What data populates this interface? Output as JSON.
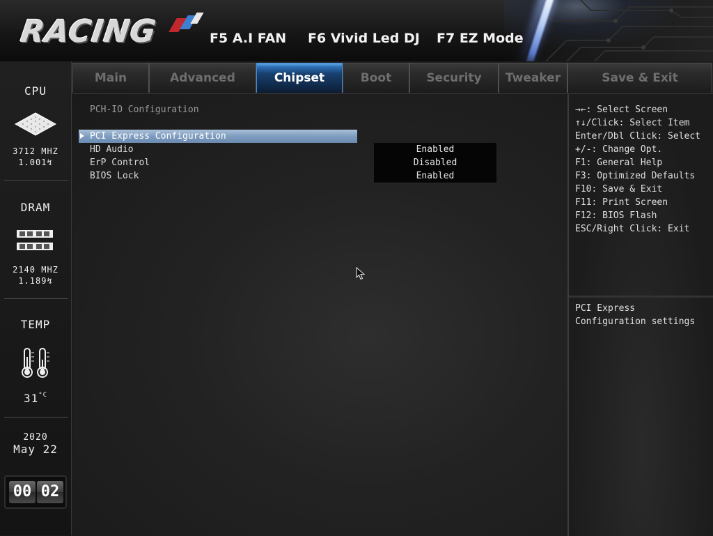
{
  "header": {
    "logo": "RACING",
    "hotkeys": [
      "F5 A.I FAN",
      "F6 Vivid Led DJ",
      "F7 EZ Mode"
    ]
  },
  "sidebar": {
    "cpu": {
      "title": "CPU",
      "freq": "3712 MHZ",
      "volt": "1.001"
    },
    "dram": {
      "title": "DRAM",
      "freq": "2140 MHZ",
      "volt": "1.189"
    },
    "temp": {
      "title": "TEMP",
      "value": "31",
      "unit": "°C"
    },
    "date": {
      "year": "2020",
      "monthday": "May 22"
    },
    "clock": {
      "hours": "00",
      "minutes": "02"
    }
  },
  "tabs": [
    "Main",
    "Advanced",
    "Chipset",
    "Boot",
    "Security",
    "Tweaker",
    "Save & Exit"
  ],
  "active_tab": "Chipset",
  "main": {
    "title": "PCH-IO Configuration",
    "items": [
      {
        "label": "PCI Express Configuration",
        "value": ""
      },
      {
        "label": "HD Audio",
        "value": "Enabled"
      },
      {
        "label": "ErP Control",
        "value": "Disabled"
      },
      {
        "label": "BIOS Lock",
        "value": "Enabled"
      }
    ]
  },
  "help": {
    "keys": [
      "→←: Select Screen",
      "↑↓/Click: Select Item",
      "Enter/Dbl Click: Select",
      "+/-: Change Opt.",
      "F1: General Help",
      "F3: Optimized Defaults",
      "F10: Save & Exit",
      "F11: Print Screen",
      "F12: BIOS Flash",
      "ESC/Right Click: Exit"
    ],
    "description": [
      "PCI Express",
      "Configuration settings"
    ]
  }
}
